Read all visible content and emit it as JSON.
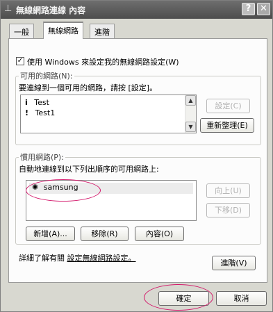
{
  "window": {
    "title": "無線網路連線 內容",
    "help": "?",
    "close": "✕"
  },
  "tabs": [
    {
      "label": "一般"
    },
    {
      "label": "無線網路"
    },
    {
      "label": "進階"
    }
  ],
  "use_windows": {
    "label": "使用 Windows 來設定我的無線網路設定(W)",
    "checked": true
  },
  "available": {
    "group_label": "可用的網路(N):",
    "desc": "要連線到一個可用的網路，請按 [設定]。",
    "items": [
      "Test",
      "Test1"
    ],
    "configure": "設定(C)",
    "refresh": "重新整理(E)"
  },
  "preferred": {
    "group_label": "慣用網路(P):",
    "desc": "自動地連線到以下列出順序的可用網路上:",
    "items": [
      "samsung"
    ],
    "move_up": "向上(U)",
    "move_down": "下移(D)",
    "add": "新增(A)...",
    "remove": "移除(R)",
    "properties": "內容(O)"
  },
  "learn": {
    "prefix": "詳細了解有關",
    "link": "設定無線網路設定。"
  },
  "advanced": "進階(V)",
  "ok": "確定",
  "cancel": "取消",
  "highlight_color": "#d3176a"
}
